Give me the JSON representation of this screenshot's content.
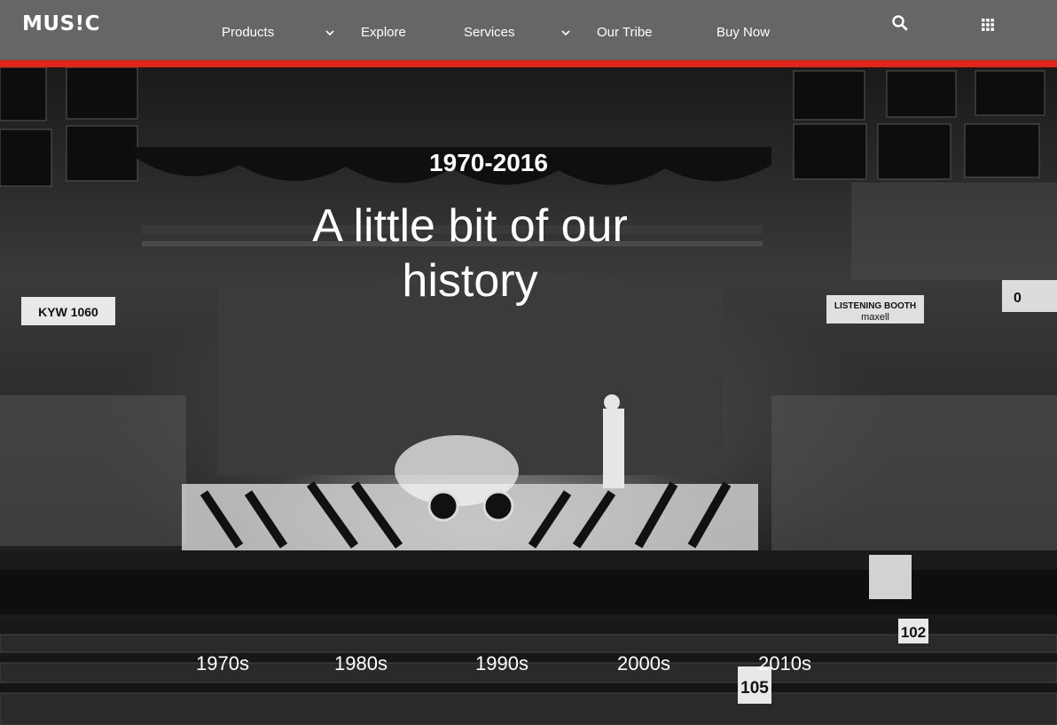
{
  "header": {
    "logo": "MUS!C",
    "nav": {
      "products": "Products",
      "explore": "Explore",
      "services": "Services",
      "our_tribe": "Our Tribe",
      "buy_now": "Buy Now"
    },
    "icons": [
      "search-icon",
      "apps-grid-icon",
      "chevron-down-icon"
    ],
    "colors": {
      "bar": "#666666",
      "accent": "#e2231a"
    }
  },
  "hero": {
    "years": "1970-2016",
    "title": "A little bit of our history",
    "signs": {
      "left_banner": "KYW 1060",
      "right_banner": "LISTENING BOOTH",
      "right_banner_sub": "maxell",
      "section_102": "102",
      "section_105": "105",
      "scoreboard": "0"
    }
  },
  "decades": [
    "1970s",
    "1980s",
    "1990s",
    "2000s",
    "2010s"
  ]
}
